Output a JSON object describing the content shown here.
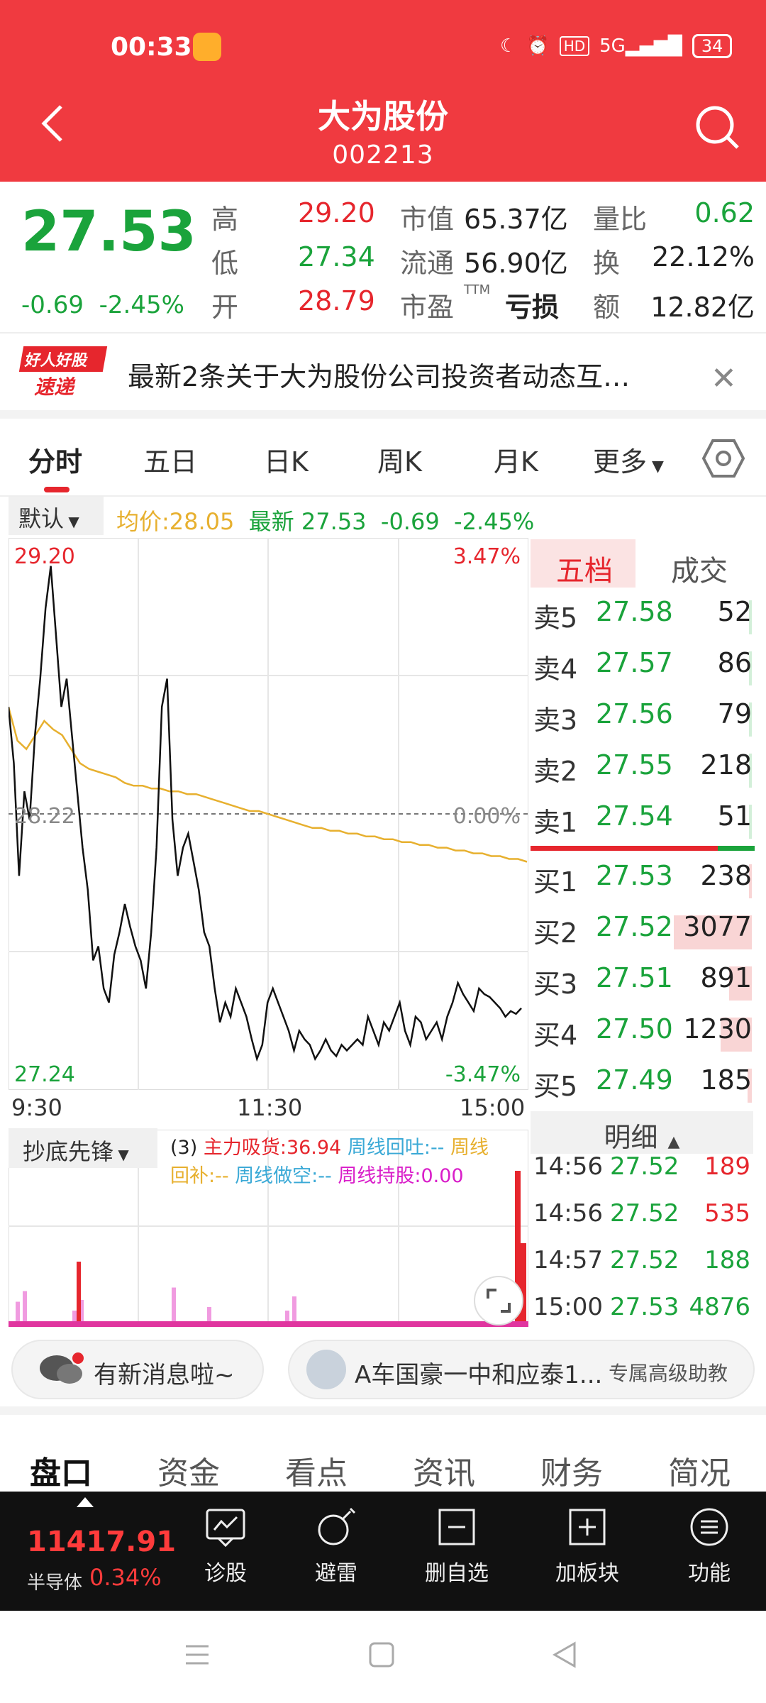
{
  "status": {
    "time": "00:33",
    "battery": "34",
    "net": "5G",
    "hd": "HD"
  },
  "header": {
    "title": "大为股份",
    "code": "002213"
  },
  "quote": {
    "price": "27.53",
    "change": "-0.69",
    "change_pct": "-2.45%",
    "high_label": "高",
    "high": "29.20",
    "low_label": "低",
    "low": "27.34",
    "open_label": "开",
    "open": "28.79",
    "mcap_label": "市值",
    "mcap": "65.37亿",
    "float_label": "流通",
    "float": "56.90亿",
    "pe_label": "市盈",
    "pe_sup": "TTM",
    "pe": "亏损",
    "vr_label": "量比",
    "vr": "0.62",
    "turnover_label": "换",
    "turnover": "22.12%",
    "amount_label": "额",
    "amount": "12.82亿"
  },
  "notice": {
    "badge_top": "好人好股",
    "badge_bottom": "速递",
    "text": "最新2条关于大为股份公司投资者动态互…"
  },
  "tabs": [
    "分时",
    "五日",
    "日K",
    "周K",
    "月K",
    "更多"
  ],
  "chart_header": {
    "mode": "默认",
    "avg": "均价:28.05",
    "latest": "最新 27.53",
    "chg": "-0.69",
    "pct": "-2.45%"
  },
  "chart_data": {
    "type": "line",
    "title": "",
    "price_range": [
      27.24,
      29.2
    ],
    "ref_price": 28.22,
    "y_labels": {
      "top": "29.20",
      "mid": "28.22",
      "bottom": "27.24",
      "top_pct": "3.47%",
      "mid_pct": "0.00%",
      "bottom_pct": "-3.47%"
    },
    "x_labels": [
      "9:30",
      "11:30",
      "15:00"
    ],
    "series": [
      {
        "values": [
          28.6,
          28.4,
          28.0,
          28.3,
          28.2,
          28.5,
          28.7,
          28.95,
          29.1,
          28.85,
          28.6,
          28.7,
          28.5,
          28.3,
          28.1,
          27.95,
          27.7,
          27.75,
          27.6,
          27.55,
          27.72,
          27.8,
          27.9,
          27.82,
          27.75,
          27.7,
          27.6,
          27.8,
          28.1,
          28.6,
          28.7,
          28.2,
          28.0,
          28.1,
          28.15,
          28.05,
          27.95,
          27.8,
          27.75,
          27.6,
          27.48,
          27.55,
          27.5,
          27.6,
          27.55,
          27.5,
          27.42,
          27.35,
          27.4,
          27.55,
          27.6,
          27.55,
          27.5,
          27.45,
          27.38,
          27.45,
          27.42,
          27.4,
          27.35,
          27.38,
          27.42,
          27.38,
          27.36,
          27.4,
          27.38,
          27.4,
          27.42,
          27.4,
          27.5,
          27.45,
          27.4,
          27.48,
          27.45,
          27.5,
          27.55,
          27.45,
          27.4,
          27.5,
          27.48,
          27.42,
          27.45,
          27.48,
          27.42,
          27.5,
          27.55,
          27.62,
          27.58,
          27.55,
          27.52,
          27.6,
          27.58,
          27.57,
          27.55,
          27.53,
          27.5,
          27.52,
          27.51,
          27.53
        ]
      },
      {
        "values": [
          28.6,
          28.48,
          28.45,
          28.5,
          28.55,
          28.52,
          28.5,
          28.45,
          28.4,
          28.38,
          28.37,
          28.36,
          28.35,
          28.33,
          28.32,
          28.32,
          28.31,
          28.31,
          28.3,
          28.3,
          28.29,
          28.29,
          28.28,
          28.27,
          28.26,
          28.25,
          28.24,
          28.23,
          28.23,
          28.22,
          28.21,
          28.2,
          28.19,
          28.18,
          28.17,
          28.17,
          28.16,
          28.16,
          28.15,
          28.15,
          28.14,
          28.14,
          28.13,
          28.13,
          28.12,
          28.12,
          28.11,
          28.11,
          28.1,
          28.1,
          28.09,
          28.09,
          28.08,
          28.08,
          28.07,
          28.07,
          28.06,
          28.06,
          28.05
        ]
      }
    ]
  },
  "orderbook": {
    "tabs": [
      "五档",
      "成交"
    ],
    "asks": [
      {
        "label": "卖5",
        "price": "27.58",
        "vol": "52"
      },
      {
        "label": "卖4",
        "price": "27.57",
        "vol": "86"
      },
      {
        "label": "卖3",
        "price": "27.56",
        "vol": "79"
      },
      {
        "label": "卖2",
        "price": "27.55",
        "vol": "218"
      },
      {
        "label": "卖1",
        "price": "27.54",
        "vol": "51"
      }
    ],
    "bids": [
      {
        "label": "买1",
        "price": "27.53",
        "vol": "238"
      },
      {
        "label": "买2",
        "price": "27.52",
        "vol": "3077"
      },
      {
        "label": "买3",
        "price": "27.51",
        "vol": "891"
      },
      {
        "label": "买4",
        "price": "27.50",
        "vol": "1230"
      },
      {
        "label": "买5",
        "price": "27.49",
        "vol": "185"
      }
    ],
    "detail_label": "明细",
    "trades": [
      {
        "time": "14:56",
        "price": "27.52",
        "vol": "189"
      },
      {
        "time": "14:56",
        "price": "27.52",
        "vol": "535"
      },
      {
        "time": "14:57",
        "price": "27.52",
        "vol": "188"
      },
      {
        "time": "15:00",
        "price": "27.53",
        "vol": "4876"
      }
    ]
  },
  "indicator": {
    "name": "抄底先锋",
    "p1": "(3)",
    "p2": "主力吸货:36.94",
    "p3": "周线回吐:--",
    "p4": "周线",
    "p5": "回补:--",
    "p6": "周线做空:--",
    "p7": "周线持股:0.00",
    "bars": [
      0.55,
      0.85,
      0.3,
      0.6,
      0.95,
      0.4,
      0.3,
      0.7
    ]
  },
  "bubbles": {
    "left": "有新消息啦~",
    "right": "A车国豪一中和应泰1...",
    "right_tag": "专属高级助教"
  },
  "bottom_tabs": [
    "盘口",
    "资金",
    "看点",
    "资讯",
    "财务",
    "简况"
  ],
  "toolbar": {
    "index_value": "11417.91",
    "index_name": "半导体",
    "index_chg": "0.34%",
    "tools": [
      "诊股",
      "避雷",
      "删自选",
      "加板块",
      "功能"
    ]
  },
  "colors": {
    "brand": "#f03a40",
    "up": "#e6262d",
    "down": "#1aa33b",
    "avg": "#e7b02f"
  }
}
